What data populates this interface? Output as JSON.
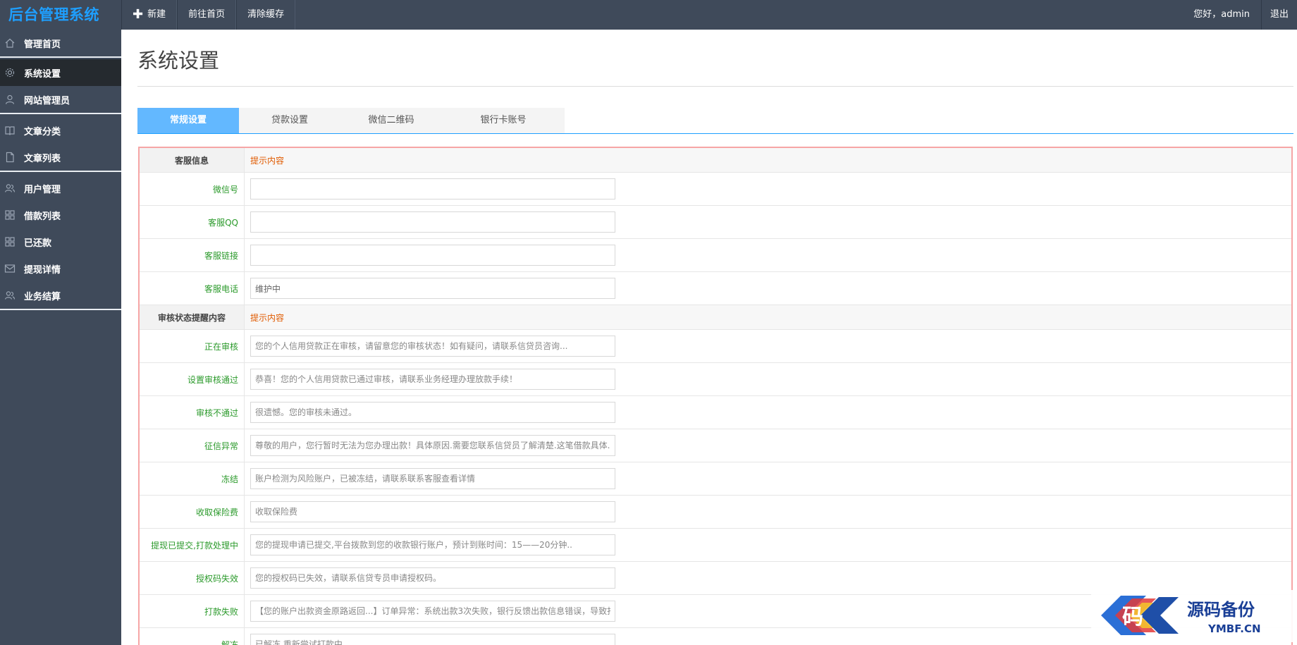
{
  "brand": {
    "title": "后台管理系统",
    "color": "#1e9fff"
  },
  "topnav": {
    "new_label": "新建",
    "home_label": "前往首页",
    "clear_cache_label": "清除缓存",
    "greeting": "您好，admin",
    "logout_label": "退出"
  },
  "sidebar": {
    "items": [
      {
        "label": "管理首页",
        "icon": "home-icon"
      },
      {
        "label": "系统设置",
        "icon": "gear-icon",
        "active": true
      },
      {
        "label": "网站管理员",
        "icon": "user-icon"
      },
      {
        "label": "文章分类",
        "icon": "book-icon"
      },
      {
        "label": "文章列表",
        "icon": "document-icon"
      },
      {
        "label": "用户管理",
        "icon": "users-icon"
      },
      {
        "label": "借款列表",
        "icon": "grid-icon"
      },
      {
        "label": "已还款",
        "icon": "grid-icon"
      },
      {
        "label": "提现详情",
        "icon": "envelope-icon"
      },
      {
        "label": "业务结算",
        "icon": "users-icon"
      }
    ]
  },
  "page": {
    "title": "系统设置"
  },
  "tabs": [
    {
      "label": "常规设置",
      "active": true
    },
    {
      "label": "贷款设置"
    },
    {
      "label": "微信二维码"
    },
    {
      "label": "银行卡账号"
    }
  ],
  "form": {
    "section1": {
      "label": "客服信息",
      "hint": "提示内容"
    },
    "wechat": {
      "label": "微信号",
      "value": "",
      "placeholder": ""
    },
    "qq": {
      "label": "客服QQ",
      "value": "",
      "placeholder": ""
    },
    "link": {
      "label": "客服链接",
      "value": "",
      "placeholder": ""
    },
    "phone": {
      "label": "客服电话",
      "value": "维护中",
      "placeholder": ""
    },
    "section2": {
      "label": "审核状态提醒内容",
      "hint": "提示内容"
    },
    "reviewing": {
      "label": "正在审核",
      "placeholder": "您的个人信用贷款正在审核，请留意您的审核状态！如有疑问，请联系信贷员咨询..."
    },
    "approved": {
      "label": "设置审核通过",
      "placeholder": "恭喜！您的个人信用贷款已通过审核，请联系业务经理办理放款手续！"
    },
    "rejected": {
      "label": "审核不通过",
      "placeholder": "很遗憾。您的审核未通过。"
    },
    "credit_abnormal": {
      "label": "征信异常",
      "placeholder": "尊敬的用户，您行暂时无法为您办理出款！具体原因.需要您联系信贷员了解清楚.这笔借款具体..."
    },
    "frozen": {
      "label": "冻结",
      "placeholder": "账户检测为风险账户，已被冻结，请联系联系客服查看详情"
    },
    "insurance": {
      "label": "收取保险费",
      "placeholder": "收取保险费"
    },
    "withdraw_submitted": {
      "label": "提现已提交,打款处理中",
      "placeholder": "您的提现申请已提交,平台拨款到您的收款银行账户，预计到账时间：15——20分钟.."
    },
    "auth_invalid": {
      "label": "授权码失效",
      "placeholder": "您的授权码已失效，请联系信贷专员申请授权码。"
    },
    "payment_failed": {
      "label": "打款失败",
      "placeholder": "【您的账户出款资金原路返回...】订单异常：系统出款3次失败，银行反馈出款信息错误，导致打..."
    },
    "unfrozen": {
      "label": "解冻",
      "placeholder": "已解冻,重新尝试打款中"
    }
  },
  "watermark": {
    "glyph": "码",
    "title": "源码备份",
    "site": "YMBF.CN"
  }
}
